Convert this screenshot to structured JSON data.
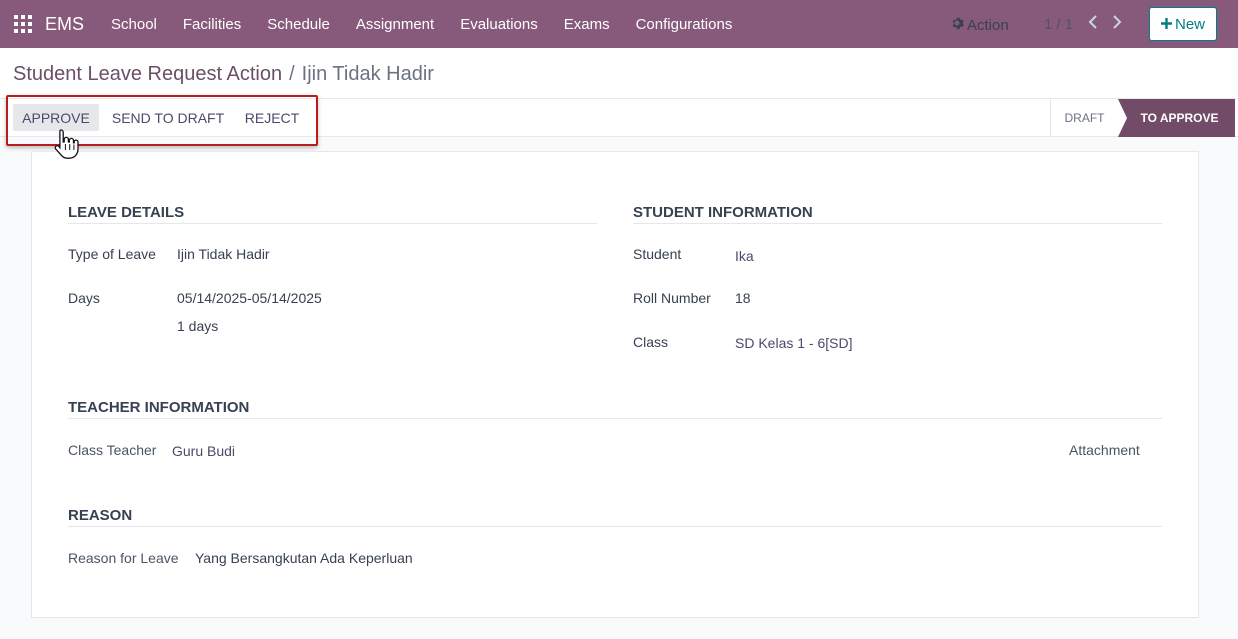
{
  "navbar": {
    "brand": "EMS",
    "items": [
      "School",
      "Facilities",
      "Schedule",
      "Assignment",
      "Evaluations",
      "Exams",
      "Configurations"
    ]
  },
  "control_panel": {
    "breadcrumb_parent": "Student Leave Request Action",
    "breadcrumb_separator": "/",
    "breadcrumb_current": "Ijin Tidak Hadir",
    "action_label": "Action",
    "pager": "1 / 1",
    "new_label": "New"
  },
  "statusbar": {
    "buttons": [
      "APPROVE",
      "SEND TO DRAFT",
      "REJECT"
    ],
    "stages": [
      "DRAFT",
      "TO APPROVE"
    ],
    "active_stage": "TO APPROVE"
  },
  "form": {
    "leave_details": {
      "title": "LEAVE DETAILS",
      "type_label": "Type of Leave",
      "type_value": "Ijin Tidak Hadir",
      "days_label": "Days",
      "days_range": "05/14/2025-05/14/2025",
      "days_count": "1 days"
    },
    "student_information": {
      "title": "STUDENT INFORMATION",
      "student_label": "Student",
      "student_value": "Ika",
      "roll_label": "Roll Number",
      "roll_value": "18",
      "class_label": "Class",
      "class_value": "SD Kelas 1 - 6[SD]"
    },
    "teacher_information": {
      "title": "TEACHER INFORMATION",
      "teacher_label": "Class Teacher",
      "teacher_value": "Guru Budi",
      "attachment_label": "Attachment"
    },
    "reason": {
      "title": "REASON",
      "reason_label": "Reason for Leave",
      "reason_value": "Yang Bersangkutan Ada Keperluan"
    }
  },
  "colors": {
    "navbar": "#875a7b",
    "active_stage": "#714b67",
    "new_button": "#017e84",
    "highlight": "#b91c1c"
  },
  "icons": [
    "apps-grid-icon",
    "gear-icon",
    "chevron-left-icon",
    "chevron-right-icon",
    "plus-icon",
    "hand-pointer-icon"
  ]
}
